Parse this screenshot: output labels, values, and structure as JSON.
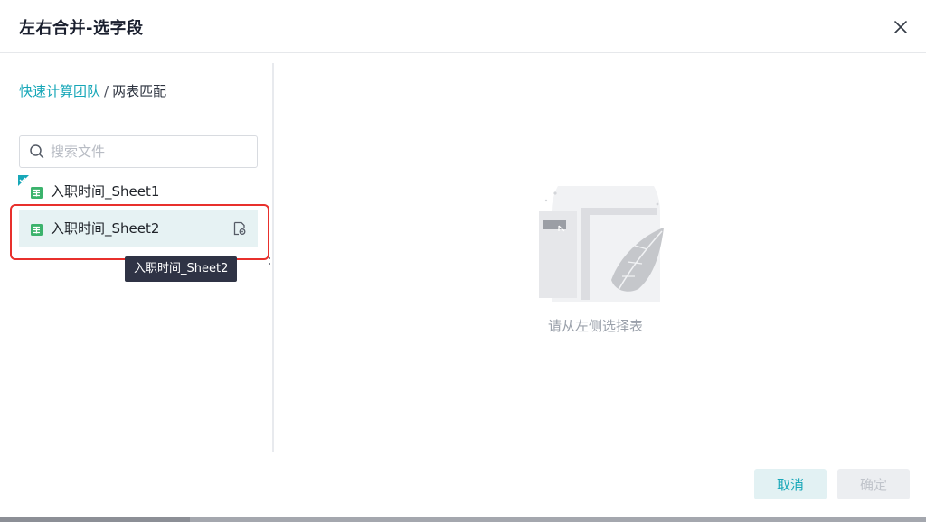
{
  "dialog": {
    "title": "左右合并-选字段",
    "close_icon": "close-icon"
  },
  "breadcrumb": {
    "parent": "快速计算团队",
    "separator": "/",
    "current": "两表匹配"
  },
  "search": {
    "placeholder": "搜索文件",
    "value": ""
  },
  "files": [
    {
      "name": "入职时间_Sheet1",
      "icon": "spreadsheet-icon",
      "selected": false
    },
    {
      "name": "入职时间_Sheet2",
      "icon": "spreadsheet-icon",
      "selected": true,
      "action_icon": "preview-icon"
    }
  ],
  "tooltip": {
    "text": "入职时间_Sheet2"
  },
  "empty_state": {
    "text": "请从左侧选择表",
    "icon": "empty-table-illustration"
  },
  "footer": {
    "cancel_label": "取消",
    "ok_label": "确定"
  },
  "colors": {
    "accent": "#17a7b8",
    "highlight": "#e8302c",
    "tooltip_bg": "#2f3345",
    "file_icon": "#3bb36c"
  }
}
